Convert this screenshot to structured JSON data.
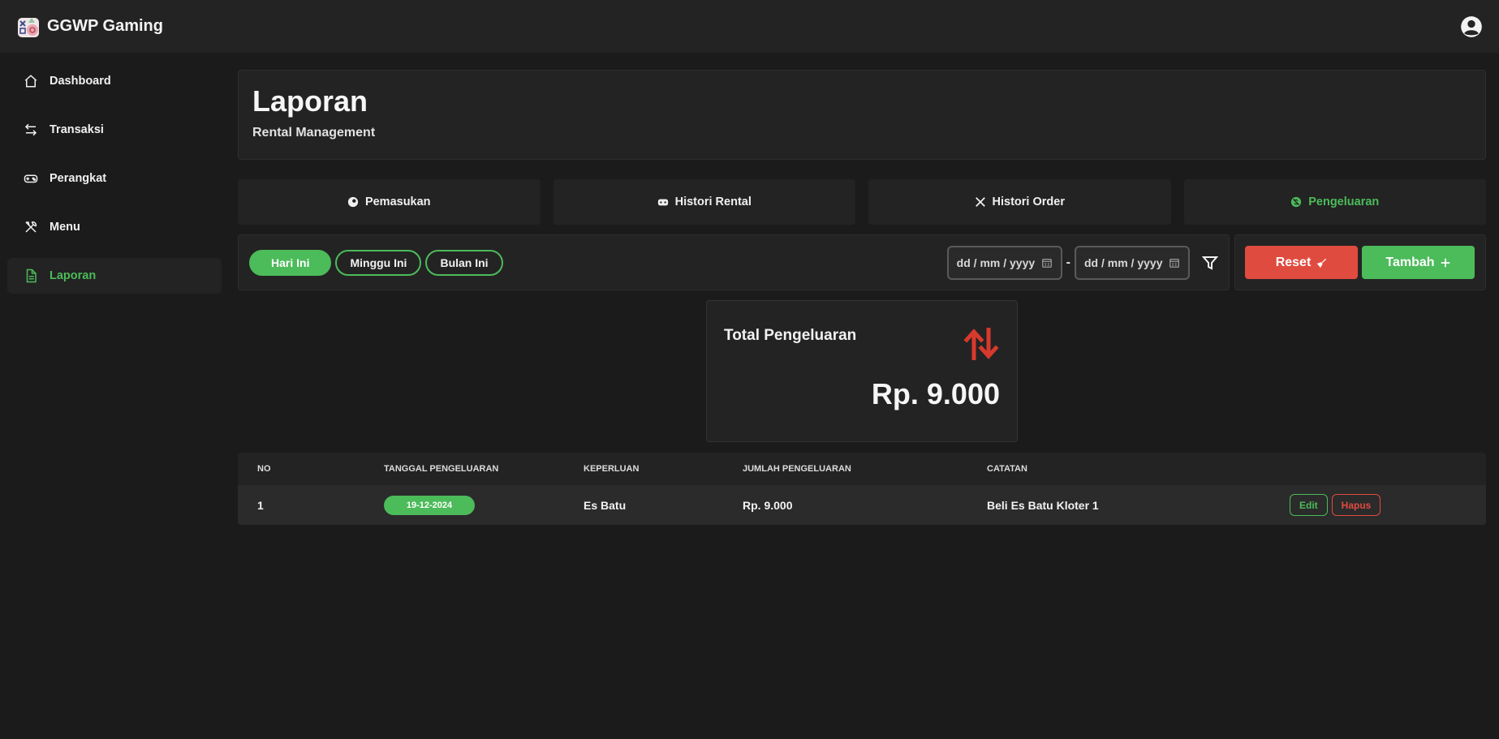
{
  "app": {
    "name": "GGWP Gaming"
  },
  "sidebar": {
    "items": [
      {
        "label": "Dashboard",
        "icon": "home-icon"
      },
      {
        "label": "Transaksi",
        "icon": "arrows-exchange-icon"
      },
      {
        "label": "Perangkat",
        "icon": "gamepad-icon"
      },
      {
        "label": "Menu",
        "icon": "utensils-icon"
      },
      {
        "label": "Laporan",
        "icon": "document-icon",
        "active": true
      }
    ]
  },
  "header": {
    "title": "Laporan",
    "subtitle": "Rental Management"
  },
  "tabs": [
    {
      "label": "Pemasukan",
      "icon": "coins-icon"
    },
    {
      "label": "Histori Rental",
      "icon": "controller-icon"
    },
    {
      "label": "Histori Order",
      "icon": "utensils-icon"
    },
    {
      "label": "Pengeluaran",
      "icon": "money-off-icon",
      "active": true
    }
  ],
  "filters": {
    "quick": [
      "Hari Ini",
      "Minggu Ini",
      "Bulan Ini"
    ],
    "active_quick": "Hari Ini",
    "date_from_placeholder": "dd / mm / yyyy",
    "date_to_placeholder": "dd / mm / yyyy",
    "date_separator": "-"
  },
  "actions": {
    "reset_label": "Reset",
    "add_label": "Tambah"
  },
  "summary": {
    "label": "Total Pengeluaran",
    "value": "Rp. 9.000"
  },
  "table": {
    "headers": [
      "NO",
      "TANGGAL PENGELUARAN",
      "KEPERLUAN",
      "JUMLAH PENGELUARAN",
      "CATATAN"
    ],
    "rows": [
      {
        "no": "1",
        "tanggal": "19-12-2024",
        "keperluan": "Es Batu",
        "jumlah": "Rp. 9.000",
        "catatan": "Beli Es Batu Kloter 1"
      }
    ],
    "edit_label": "Edit",
    "delete_label": "Hapus"
  },
  "colors": {
    "accent": "#4cbb5a",
    "danger": "#e04b3f",
    "background": "#1b1b1b",
    "card": "#232323"
  }
}
